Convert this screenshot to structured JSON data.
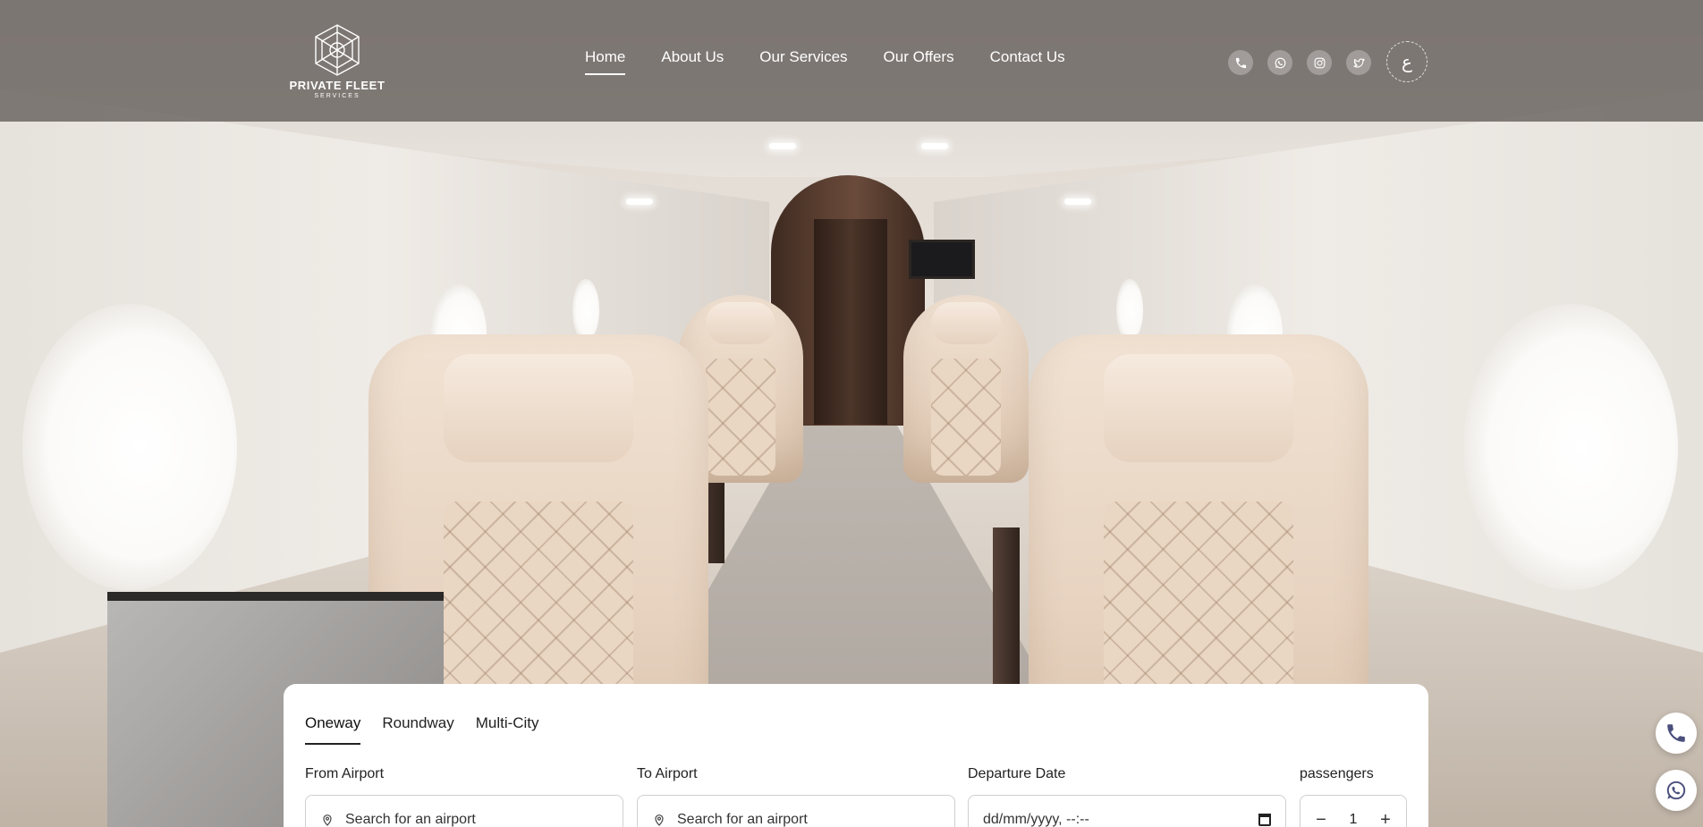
{
  "brand": {
    "name": "PRIVATE FLEET",
    "subtitle": "SERVICES"
  },
  "nav": {
    "items": [
      {
        "label": "Home",
        "active": true
      },
      {
        "label": "About Us",
        "active": false
      },
      {
        "label": "Our Services",
        "active": false
      },
      {
        "label": "Our Offers",
        "active": false
      },
      {
        "label": "Contact Us",
        "active": false
      }
    ]
  },
  "socials": [
    {
      "icon": "phone-icon"
    },
    {
      "icon": "whatsapp-icon"
    },
    {
      "icon": "instagram-icon"
    },
    {
      "icon": "twitter-icon"
    }
  ],
  "language_toggle": {
    "label": "ع"
  },
  "booking": {
    "tabs": [
      {
        "label": "Oneway",
        "active": true
      },
      {
        "label": "Roundway",
        "active": false
      },
      {
        "label": "Multi-City",
        "active": false
      }
    ],
    "from": {
      "label": "From Airport",
      "placeholder": "Search for an airport"
    },
    "to": {
      "label": "To Airport",
      "placeholder": "Search for an airport"
    },
    "departure": {
      "label": "Departure Date",
      "value": "dd/mm/yyyy, --:--"
    },
    "passengers": {
      "label": "passengers",
      "value": "1",
      "decrement": "−",
      "increment": "+"
    }
  },
  "floating": [
    {
      "icon": "phone-icon"
    },
    {
      "icon": "whatsapp-icon"
    }
  ],
  "colors": {
    "header_overlay": "#68625e",
    "accent_icon": "#4a4f7c",
    "card_bg": "#ffffff"
  }
}
